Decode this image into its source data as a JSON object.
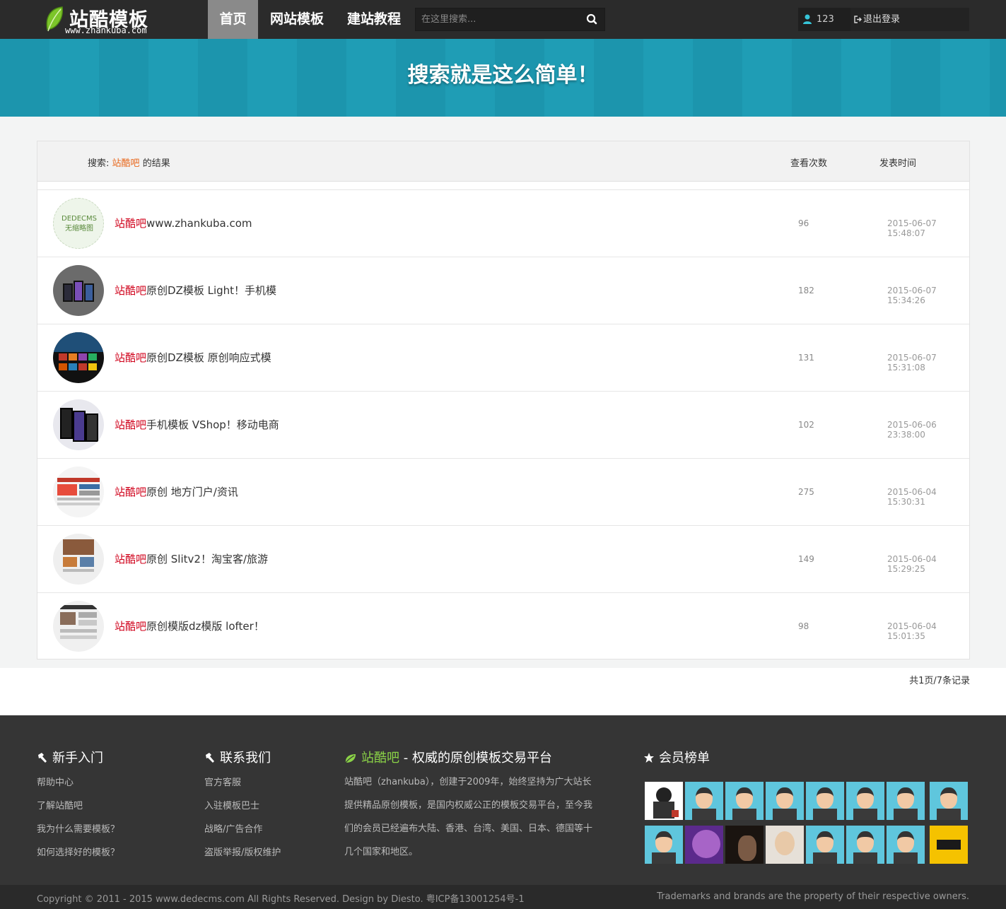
{
  "header": {
    "logo_name": "站酷模板",
    "logo_url": "www.zhankuba.com",
    "nav": [
      {
        "label": "首页",
        "active": true
      },
      {
        "label": "网站模板",
        "active": false
      },
      {
        "label": "建站教程",
        "active": false
      }
    ],
    "search": {
      "placeholder": "在这里搜索..."
    },
    "user": {
      "name": "123",
      "logout_label": "退出登录"
    }
  },
  "banner": {
    "title": "搜索就是这么简单！"
  },
  "results": {
    "header": {
      "prefix": "搜索:",
      "keyword": "站酷吧",
      "suffix": "的结果",
      "views_label": "查看次数",
      "date_label": "发表时间"
    },
    "items": [
      {
        "kw": "站酷吧",
        "title": "www.zhankuba.com",
        "views": "96",
        "date": "2015-06-07 15:48:07",
        "thumb": "DEDECMS 无缩略图"
      },
      {
        "kw": "站酷吧",
        "title": "原创DZ模板 Light！手机模",
        "views": "182",
        "date": "2015-06-07 15:34:26"
      },
      {
        "kw": "站酷吧",
        "title": "原创DZ模板 原创响应式模",
        "views": "131",
        "date": "2015-06-07 15:31:08"
      },
      {
        "kw": "站酷吧",
        "title": "手机模板 VShop！移动电商",
        "views": "102",
        "date": "2015-06-06 23:38:00"
      },
      {
        "kw": "站酷吧",
        "title": "原创 地方门户/资讯",
        "views": "275",
        "date": "2015-06-04 15:30:31"
      },
      {
        "kw": "站酷吧",
        "title": "原创 Slitv2！淘宝客/旅游",
        "views": "149",
        "date": "2015-06-04 15:29:25"
      },
      {
        "kw": "站酷吧",
        "title": "原创模版dz模版 lofter！",
        "views": "98",
        "date": "2015-06-04 15:01:35"
      }
    ],
    "pager": "共1页/7条记录"
  },
  "footer": {
    "newbie": {
      "title": "新手入门",
      "links": [
        "帮助中心",
        "了解站酷吧",
        "我为什么需要模板？",
        "如何选择好的模板？"
      ]
    },
    "contact": {
      "title": "联系我们",
      "links": [
        "官方客服",
        "入驻模板巴士",
        "战略/广告合作",
        "盗版举报/版权维护"
      ]
    },
    "about": {
      "brand": "站酷吧",
      "title": " - 权威的原创模板交易平台",
      "text": "站酷吧（zhankuba），创建于2009年，始终坚持为广大站长提供精品原创模板，是国内权威公正的模板交易平台，至今我们的会员已经遍布大陆、香港、台湾、美国、日本、德国等十几个国家和地区。"
    },
    "members": {
      "title": "会员榜单"
    },
    "copyright": "Copyright © 2011 - 2015 www.dedecms.com All Rights Reserved. Design by Diesto. 粤ICP备13001254号-1",
    "trademark": "Trademarks and brands are the property of their respective owners."
  },
  "colors": {
    "topbar": "#2b2b2b",
    "banner": "#1f9db5",
    "keyword": "#d0021b",
    "brand_green": "#8bd347",
    "footer": "#353535"
  }
}
